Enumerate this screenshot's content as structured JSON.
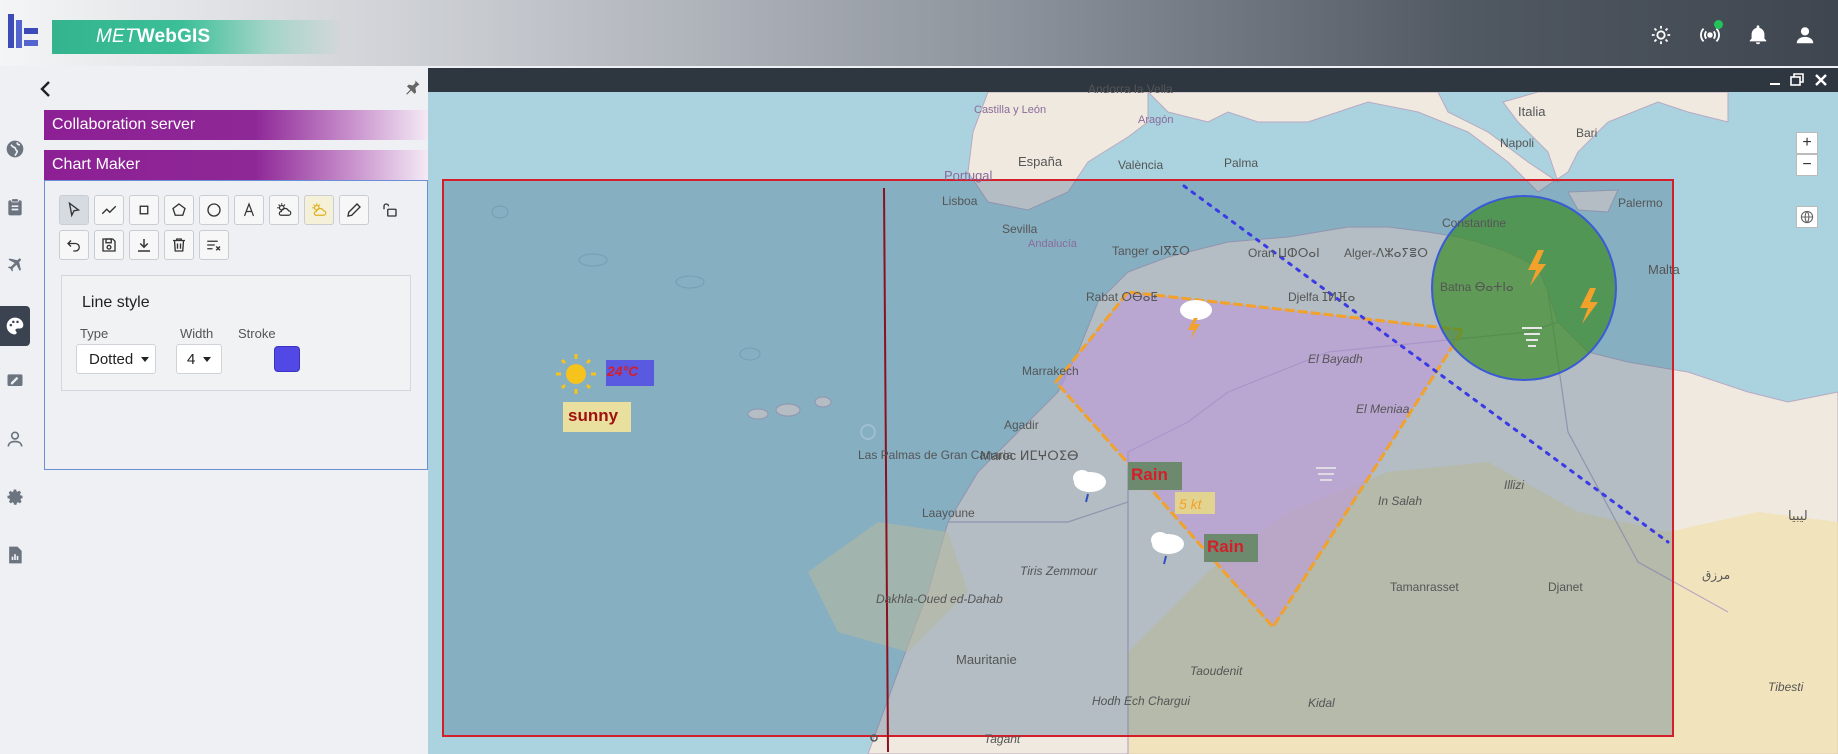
{
  "header": {
    "brand_met": "MET",
    "brand_webgis": "WebGIS",
    "icons": [
      "theme-sun-icon",
      "broadcast-icon",
      "notifications-bell-icon",
      "user-account-icon"
    ],
    "status_dot_color": "#21c35a"
  },
  "rail": {
    "icons": [
      "globe-icon",
      "clipboard-icon",
      "airplane-icon",
      "palette-icon",
      "edit-chart-icon",
      "person-icon",
      "settings-gear-icon",
      "report-chart-icon"
    ],
    "active": "palette-icon"
  },
  "panel": {
    "sections": [
      "Collaboration server",
      "Chart Maker"
    ],
    "line_style": {
      "title": "Line style",
      "type_label": "Type",
      "type_value": "Dotted",
      "width_label": "Width",
      "width_value": "4",
      "stroke_label": "Stroke",
      "stroke_color": "#5248e6"
    }
  },
  "map": {
    "labels": {
      "andorra": "Andorra la Vella",
      "italia": "Italia",
      "napoli": "Napoli",
      "bari": "Bari",
      "aragon": "Aragón",
      "castilla": "Castilla y León",
      "espana": "España",
      "valencia": "València",
      "palma": "Palma",
      "portugal": "Portugal",
      "lisboa": "Lisboa",
      "sevilla": "Sevilla",
      "andalucia": "Andalucía",
      "palermo": "Palermo",
      "malta": "Malta",
      "constantine": "Constantine",
      "tanger": "Tanger ⴰⵏⴳⵉⵔ",
      "oran": "Oran ⵡⵀⵔⴰⵏ",
      "alger": "Alger-ⴷⵣⴰⵢⴻⵔ",
      "batna": "Batna ⴱⴰⵜⵏⴰ",
      "rabat": "Rabat ⵔⴱⴰⵟ",
      "djelfa": "Djelfa ⵊⵍⴼⴰ",
      "marrakech": "Marrakech",
      "agadir": "Agadir",
      "maroc": "Maroc ⵍⵎⵖⵔⵉⴱ",
      "el_bayadh": "El Bayadh",
      "el_meniaa": "El Meniaa",
      "las_palmas": "Las Palmas de Gran Canaria",
      "laayoune": "Laayoune",
      "tiris": "Tiris Zemmour",
      "dakhla": "Dakhla-Oued ed-Dahab",
      "mauritanie": "Mauritanie",
      "hodh": "Hodh Ech Chargui",
      "tagant": "Tagant",
      "djanet": "Djanet",
      "tamanrasset": "Tamanrasset",
      "kidal": "Kidal",
      "tibesti": "Tibesti",
      "in_salah": "In Salah",
      "illizi": "Illizi",
      "taoudenit": "Taoudenit",
      "libya": "ليبيا",
      "murzuq": "مرزق"
    },
    "annotations": {
      "sunny": "sunny",
      "temp": "24°C",
      "rain1": "Rain",
      "rain2": "Rain",
      "wind": "5 kt"
    },
    "colors": {
      "rectangle_border": "#d41f2a",
      "polygon_fill": "#b79ad8",
      "polygon_border": "#f2a12a",
      "circle_fill": "#3f8f2a",
      "circle_border": "#3a5ad6",
      "dotted_line": "#3a3ae6"
    }
  }
}
